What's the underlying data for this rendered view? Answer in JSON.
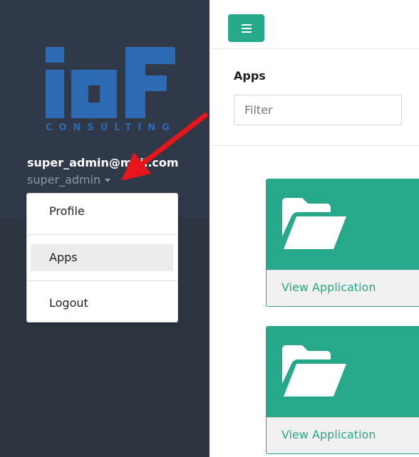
{
  "brand": {
    "logo_text": "iaF",
    "tagline": "CONSULTING"
  },
  "user": {
    "email": "super_admin@mail.com",
    "username": "super_admin"
  },
  "user_menu": {
    "items": [
      {
        "label": "Profile"
      },
      {
        "label": "Apps",
        "active": true
      },
      {
        "label": "Logout"
      }
    ]
  },
  "toolbar": {
    "menu_icon": "hamburger-icon"
  },
  "apps": {
    "section_title": "Apps",
    "filter_placeholder": "Filter",
    "cards": [
      {
        "icon": "folder-open-icon",
        "link_label": "View Application"
      },
      {
        "icon": "folder-open-icon",
        "link_label": "View Application"
      }
    ]
  },
  "colors": {
    "sidebar": "#2d3541",
    "accent": "#26a98a",
    "logo_blue": "#2d6ab4",
    "annotation_arrow": "#e8151b"
  }
}
